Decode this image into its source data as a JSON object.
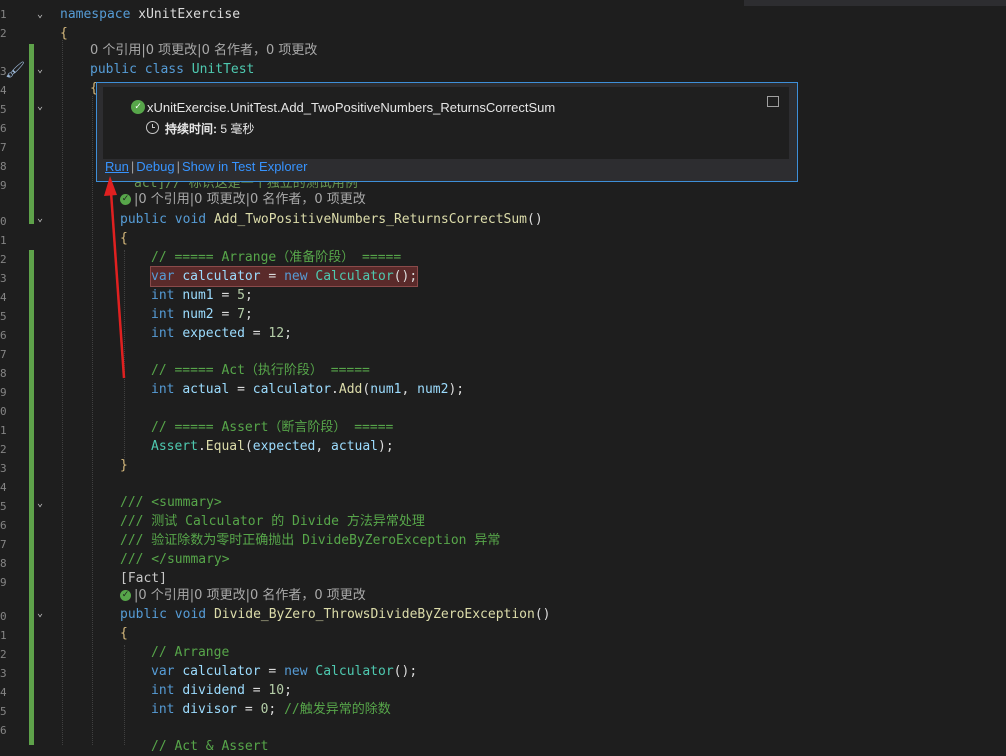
{
  "line_numbers": [
    "1",
    "2",
    "3",
    "4",
    "5",
    "6",
    "7",
    "8",
    "9",
    "0",
    "1",
    "2",
    "3",
    "4",
    "5",
    "6",
    "7",
    "8",
    "9",
    "0",
    "1",
    "2",
    "3",
    "4",
    "5",
    "6",
    "7",
    "8",
    "9",
    "0",
    "1",
    "2",
    "3",
    "4",
    "5",
    "6",
    "7",
    "8",
    "9",
    "0"
  ],
  "codelens": {
    "class_lens": "0 个引用|0 项更改|0 名作者，0 项更改",
    "method1_lens": "|0 个引用|0 项更改|0 名作者，0 项更改",
    "method2_lens": "|0 个引用|0 项更改|0 名作者，0 项更改"
  },
  "code": {
    "namespace_kw": "namespace",
    "namespace_name": "xUnitExercise",
    "open_brace": "{",
    "public_kw": "public",
    "class_kw": "class",
    "class_name": "UnitTest",
    "line9_partial": "act]// 标识这是一个独立的测试用例",
    "void_kw": "void",
    "method1_name": "Add_TwoPositiveNumbers_ReturnsCorrectSum",
    "paren_pair": "()",
    "arrange_comment": "// ===== Arrange（准备阶段） =====",
    "var_kw": "var",
    "calculator_var": "calculator",
    "new_kw": "new",
    "calculator_type": "Calculator",
    "int_kw": "int",
    "num1": "num1",
    "num1_val": "5",
    "num2": "num2",
    "num2_val": "7",
    "expected": "expected",
    "expected_val": "12",
    "act_comment": "// ===== Act（执行阶段） =====",
    "actual": "actual",
    "add_method": "Add",
    "assert_comment": "// ===== Assert（断言阶段） =====",
    "assert_type": "Assert",
    "equal_method": "Equal",
    "close_brace": "}",
    "summary_open": "/// <summary>",
    "summary_l1": "/// 测试 Calculator 的 Divide 方法异常处理",
    "summary_l2": "/// 验证除数为零时正确抛出 DivideByZeroException 异常",
    "summary_close": "/// </summary>",
    "fact_attr": "[Fact]",
    "method2_name": "Divide_ByZero_ThrowsDivideByZeroException",
    "arrange_simple": "// Arrange",
    "dividend": "dividend",
    "dividend_val": "10",
    "divisor": "divisor",
    "divisor_val": "0",
    "divisor_comment": "//触发异常的除数",
    "last_partial": "// Act & Assert"
  },
  "popup": {
    "test_name": "xUnitExercise.UnitTest.Add_TwoPositiveNumbers_ReturnsCorrectSum",
    "duration_label": "持续时间:",
    "duration_value": "5 毫秒",
    "run_link": "Run",
    "debug_link": "Debug",
    "explorer_link": "Show in Test Explorer"
  },
  "colors": {
    "background": "#1e1e1e",
    "keyword": "#569cd6",
    "type": "#4ec9b0",
    "comment": "#57a64a",
    "link": "#3794ff",
    "annotation_arrow": "#e02020",
    "popup_border": "#3e8fd8"
  }
}
